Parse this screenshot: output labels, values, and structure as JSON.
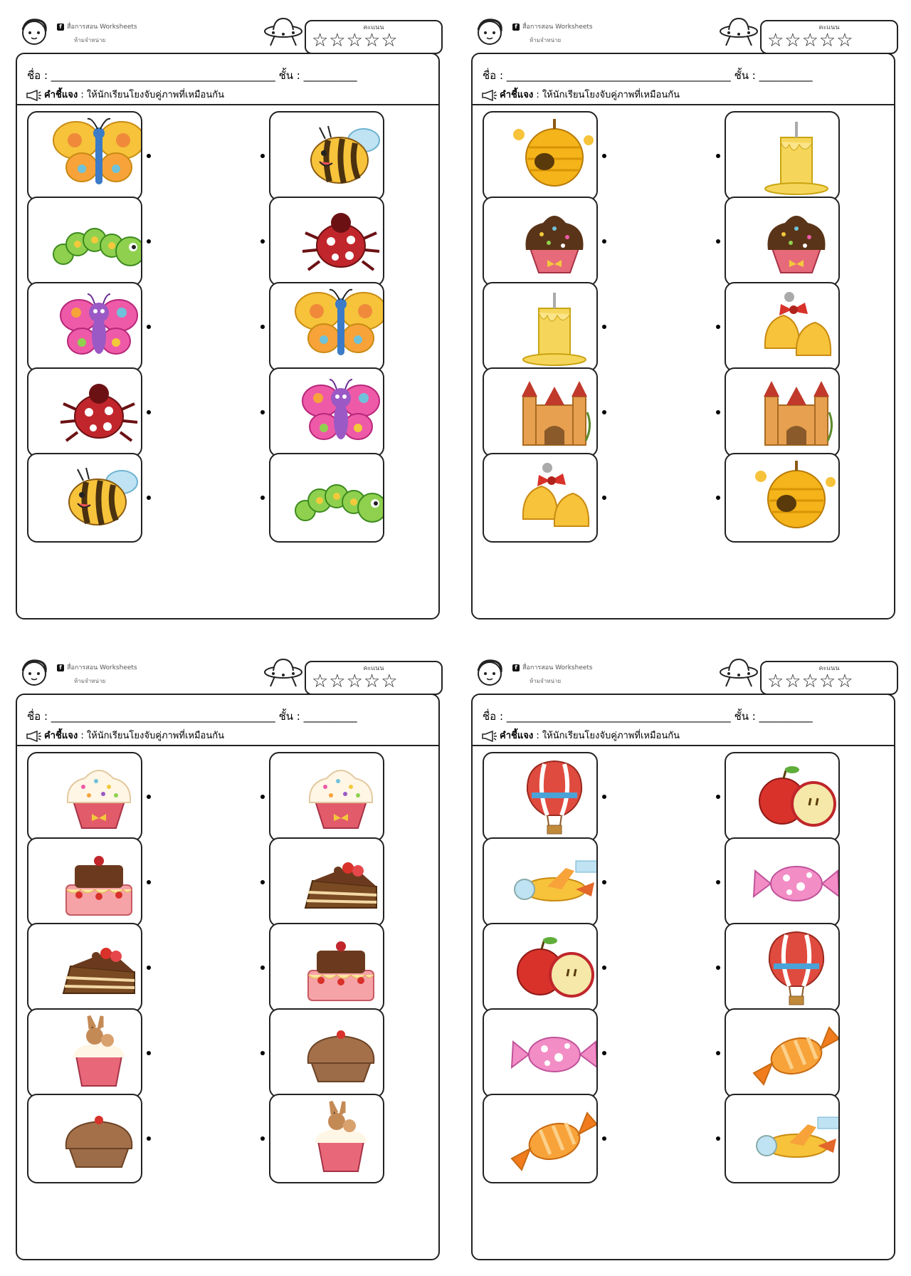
{
  "header": {
    "brand": "สื่อการสอน Worksheets",
    "brand_sub": "ห้ามจำหน่าย",
    "score_label": "คะแนน",
    "stars": "☆☆☆☆☆"
  },
  "form": {
    "name_label": "ชื่อ :",
    "name_blank": "__________________________________________",
    "class_label": "ชั้น :",
    "class_blank": "__________"
  },
  "instruction": {
    "label": "คำชี้แจง",
    "text": ": ให้นักเรียนโยงจับคู่ภาพที่เหมือนกัน"
  },
  "icons": {
    "face": "child-face-icon",
    "ufo": "ufo-icon",
    "megaphone": "megaphone-icon",
    "facebook": "facebook-icon"
  },
  "sheets": [
    {
      "left": [
        "butterfly-orange",
        "caterpillar",
        "butterfly-pink",
        "ladybug",
        "bee"
      ],
      "right": [
        "bee",
        "ladybug",
        "butterfly-orange",
        "butterfly-pink",
        "caterpillar"
      ]
    },
    {
      "left": [
        "beehive",
        "chocolate-cupcake",
        "candle",
        "castle",
        "bells"
      ],
      "right": [
        "candle",
        "chocolate-cupcake",
        "bells",
        "castle",
        "beehive"
      ]
    },
    {
      "left": [
        "sprinkle-cupcake",
        "layer-cake",
        "cake-slice",
        "bunny-cupcake",
        "muffin"
      ],
      "right": [
        "sprinkle-cupcake",
        "cake-slice",
        "layer-cake",
        "muffin",
        "bunny-cupcake"
      ]
    },
    {
      "left": [
        "hot-air-balloon",
        "airplane",
        "apple",
        "pink-candy",
        "orange-candy"
      ],
      "right": [
        "apple",
        "pink-candy",
        "hot-air-balloon",
        "orange-candy",
        "airplane"
      ]
    }
  ]
}
